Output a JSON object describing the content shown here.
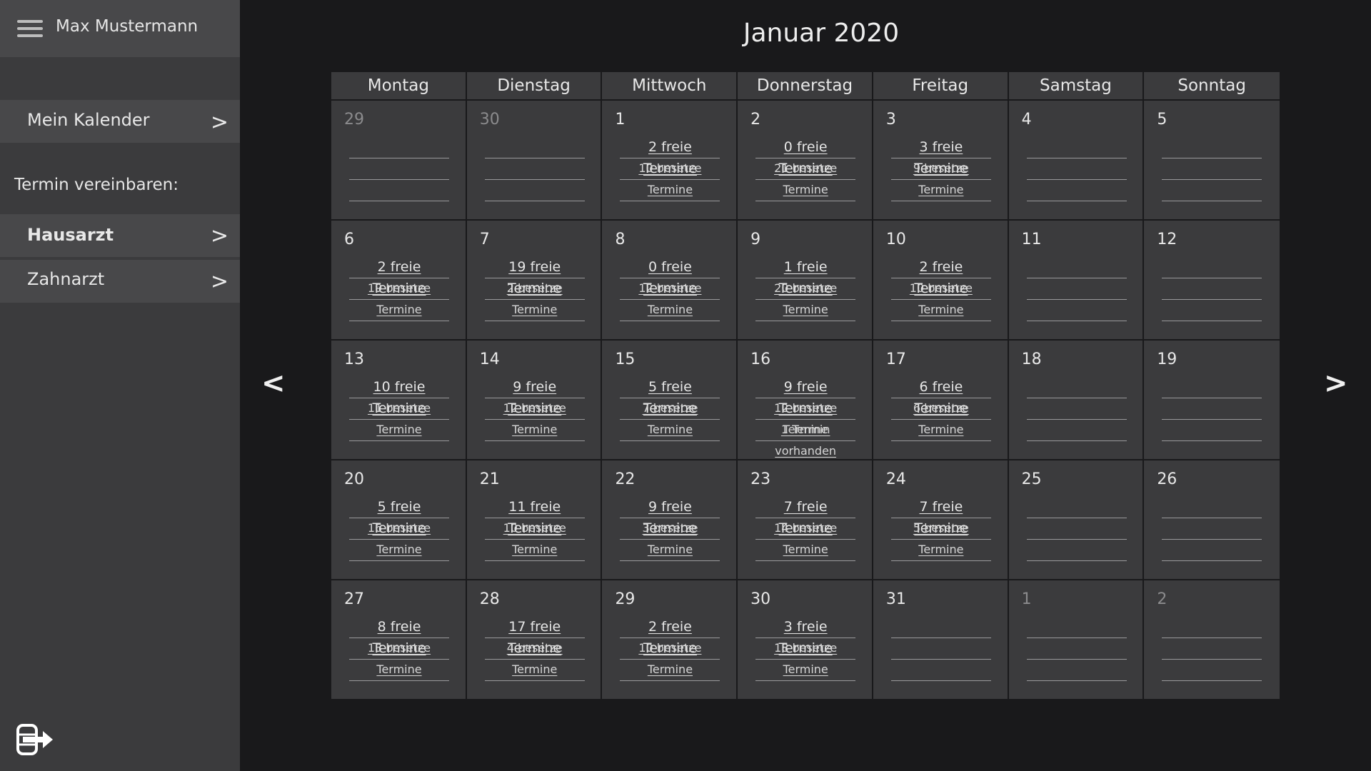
{
  "user": {
    "name": "Max Mustermann"
  },
  "sidebar": {
    "my_calendar": "Mein Kalender",
    "section_label": "Termin vereinbaren:",
    "items": [
      {
        "label": "Hausarzt",
        "active": true
      },
      {
        "label": "Zahnarzt",
        "active": false
      }
    ],
    "chevron": ">"
  },
  "calendar": {
    "title": "Januar 2020",
    "prev": "<",
    "next": ">",
    "weekdays": [
      "Montag",
      "Dienstag",
      "Mittwoch",
      "Donnerstag",
      "Freitag",
      "Samstag",
      "Sonntag"
    ],
    "weeks": [
      [
        {
          "day": "29",
          "muted": true
        },
        {
          "day": "30",
          "muted": true
        },
        {
          "day": "1",
          "free": "2 freie Termine",
          "booked": "10 besetze Termine"
        },
        {
          "day": "2",
          "free": "0 freie Termine",
          "booked": "21 besetze Termine"
        },
        {
          "day": "3",
          "free": "3 freie Termine",
          "booked": "9 besetze Termine"
        },
        {
          "day": "4"
        },
        {
          "day": "5"
        }
      ],
      [
        {
          "day": "6",
          "free": "2 freie Termine",
          "booked": "19 besetze Termine"
        },
        {
          "day": "7",
          "free": "19 freie Termine",
          "booked": "2 besetze Termine"
        },
        {
          "day": "8",
          "free": "0 freie Termine",
          "booked": "12 besetze Termine"
        },
        {
          "day": "9",
          "free": "1 freie Termine",
          "booked": "20 besetze Termine"
        },
        {
          "day": "10",
          "free": "2 freie Termine",
          "booked": "10 besetze Termine"
        },
        {
          "day": "11"
        },
        {
          "day": "12"
        }
      ],
      [
        {
          "day": "13",
          "free": "10 freie Termine",
          "booked": "11 besetze Termine"
        },
        {
          "day": "14",
          "free": "9 freie Termine",
          "booked": "12 besetze Termine"
        },
        {
          "day": "15",
          "free": "5 freie Termine",
          "booked": "7 besetze Termine"
        },
        {
          "day": "16",
          "free": "9 freie Termine",
          "booked": "12 besetze Termine",
          "own": "1 Termin vorhanden"
        },
        {
          "day": "17",
          "free": "6 freie Termine",
          "booked": "6 besetze Termine"
        },
        {
          "day": "18"
        },
        {
          "day": "19"
        }
      ],
      [
        {
          "day": "20",
          "free": "5 freie Termine",
          "booked": "16 besetze Termine"
        },
        {
          "day": "21",
          "free": "11 freie Termine",
          "booked": "10 besetze Termine"
        },
        {
          "day": "22",
          "free": "9 freie Termine",
          "booked": "3 besetze Termine"
        },
        {
          "day": "23",
          "free": "7 freie Termine",
          "booked": "14 besetze Termine"
        },
        {
          "day": "24",
          "free": "7 freie Termine",
          "booked": "5 besetze Termine"
        },
        {
          "day": "25"
        },
        {
          "day": "26"
        }
      ],
      [
        {
          "day": "27",
          "free": "8 freie Termine",
          "booked": "13 besetze Termine"
        },
        {
          "day": "28",
          "free": "17 freie Termine",
          "booked": "4 besetze Termine"
        },
        {
          "day": "29",
          "free": "2 freie Termine",
          "booked": "10 besetze Termine"
        },
        {
          "day": "30",
          "free": "3 freie Termine",
          "booked": "18 besetze Termine"
        },
        {
          "day": "31"
        },
        {
          "day": "1",
          "muted": true
        },
        {
          "day": "2",
          "muted": true
        }
      ]
    ]
  },
  "icons": {
    "menu": "hamburger-icon",
    "logout": "logout-icon"
  },
  "colors": {
    "background": "#19191b",
    "panel": "#3b3b3d",
    "panel_highlight": "#48484a",
    "text": "#e8e8e8",
    "muted_text": "#8b8b8d"
  }
}
